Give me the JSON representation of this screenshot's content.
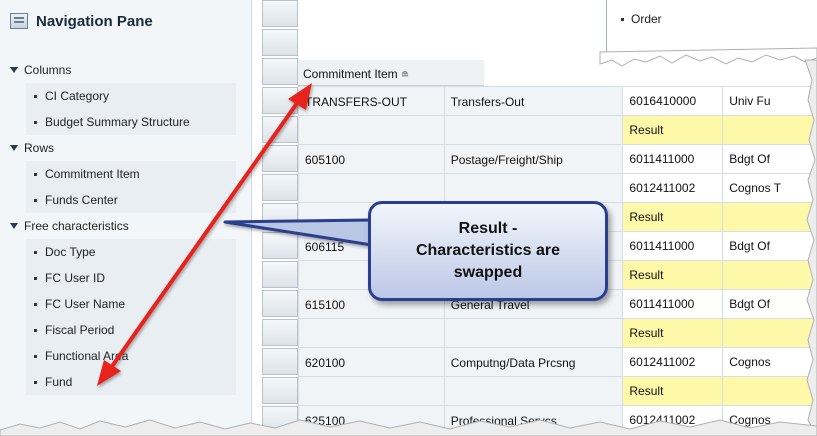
{
  "nav": {
    "title": "Navigation Pane",
    "sections": [
      {
        "label": "Columns",
        "items": [
          "CI Category",
          "Budget Summary Structure"
        ]
      },
      {
        "label": "Rows",
        "items": [
          "Commitment Item",
          "Funds Center"
        ]
      },
      {
        "label": "Free characteristics",
        "items": [
          "Doc Type",
          "FC User ID",
          "FC User Name",
          "Fiscal Period",
          "Functional Area",
          "Fund"
        ]
      }
    ]
  },
  "grid": {
    "order_label": "Order",
    "column_header": "Commitment Item",
    "sort_glyph": "≘",
    "rows": [
      {
        "c1": "TRANSFERS-OUT",
        "c2": "Transfers-Out",
        "c3": "6016410000",
        "c4": "Univ Fu",
        "result": false
      },
      {
        "c1": "",
        "c2": "",
        "c3": "Result",
        "c4": "",
        "result": true
      },
      {
        "c1": "605100",
        "c2": "Postage/Freight/Ship",
        "c3": "6011411000",
        "c4": "Bdgt Of",
        "result": false
      },
      {
        "c1": "",
        "c2": "",
        "c3": "6012411002",
        "c4": "Cognos T",
        "result": false
      },
      {
        "c1": "",
        "c2": "",
        "c3": "Result",
        "c4": "",
        "result": true
      },
      {
        "c1": "606115",
        "c2": "",
        "c3": "6011411000",
        "c4": "Bdgt Of",
        "result": false
      },
      {
        "c1": "",
        "c2": "",
        "c3": "Result",
        "c4": "",
        "result": true
      },
      {
        "c1": "615100",
        "c2": "General Travel",
        "c3": "6011411000",
        "c4": "Bdgt Of",
        "result": false
      },
      {
        "c1": "",
        "c2": "",
        "c3": "Result",
        "c4": "",
        "result": true
      },
      {
        "c1": "620100",
        "c2": "Computng/Data Prcsng",
        "c3": "6012411002",
        "c4": "Cognos",
        "result": false
      },
      {
        "c1": "",
        "c2": "",
        "c3": "Result",
        "c4": "",
        "result": true
      },
      {
        "c1": "625100",
        "c2": "Professional Servcs",
        "c3": "6012411002",
        "c4": "Cognos",
        "result": false
      }
    ]
  },
  "callout": {
    "text": "Result -\nCharacteristics are\nswapped"
  },
  "colors": {
    "arrow": "#e8211c",
    "callout_border": "#2a3f8f",
    "result_fill": "#fef9a8"
  }
}
